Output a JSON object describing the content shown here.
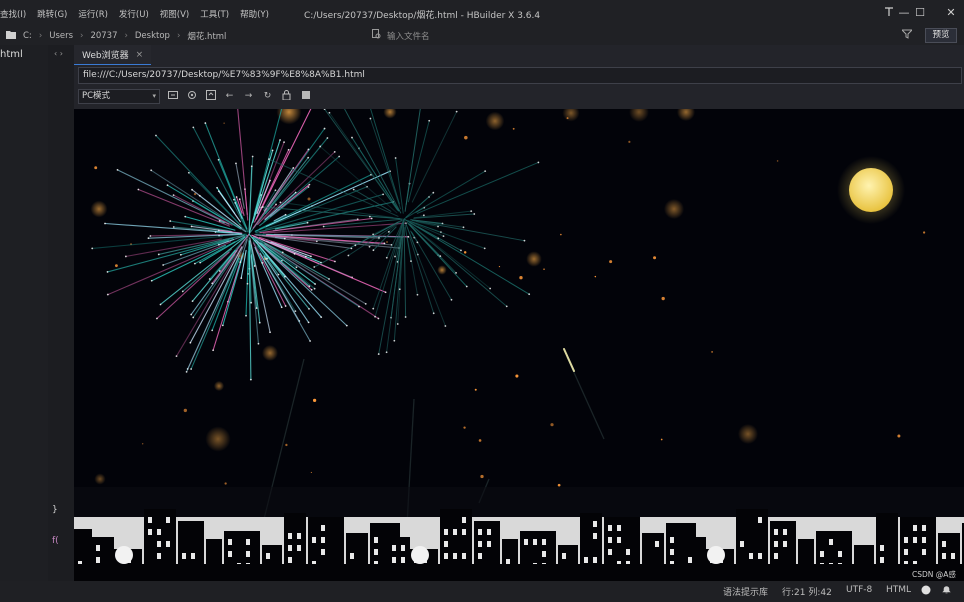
{
  "menubar": {
    "items": [
      "查找(I)",
      "跳转(G)",
      "运行(R)",
      "发行(U)",
      "视图(V)",
      "工具(T)",
      "帮助(Y)"
    ],
    "window_title": "C:/Users/20737/Desktop/烟花.html - HBuilder X 3.6.4",
    "controls": {
      "pin": "pin-icon",
      "minimize": "—",
      "maximize": "☐",
      "close": "✕"
    }
  },
  "toolbar": {
    "breadcrumb": [
      "C:",
      "Users",
      "20737",
      "Desktop",
      "烟花.html"
    ],
    "search_placeholder": "输入文件名",
    "preview_label": "预览"
  },
  "explorer": {
    "file_name": "html"
  },
  "gutter": {
    "brace": "}",
    "fn": "f("
  },
  "browser": {
    "tab_label": "Web浏览器",
    "tab_close": "×",
    "url": "file:///C:/Users/20737/Desktop/%E7%83%9F%E8%8A%B1.html",
    "mode": "PC模式",
    "tools": [
      "screenshot-icon",
      "settings-icon",
      "devtools-icon",
      "back-icon",
      "forward-icon",
      "refresh-icon",
      "lock-icon",
      "fullscreen-icon"
    ]
  },
  "status": {
    "hint": "语法提示库",
    "position": "行:21  列:42",
    "encoding": "UTF-8",
    "language": "HTML"
  },
  "watermark": "CSDN @A感",
  "colors": {
    "accent": "#3a7bd5",
    "moon": "#f1d35e",
    "sky": "#020309"
  }
}
